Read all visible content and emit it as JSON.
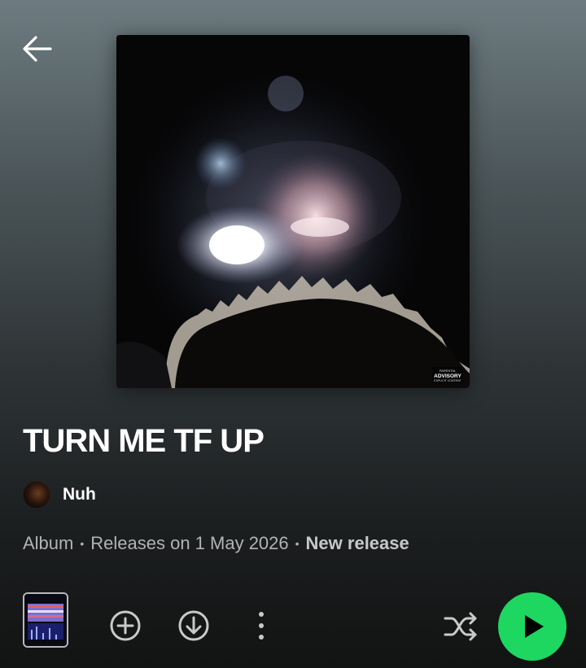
{
  "header": {
    "back_icon": "arrow-left-icon"
  },
  "album": {
    "title": "TURN ME TF UP",
    "artist": "Nuh",
    "type": "Album",
    "release_text": "Releases on 1 May 2026",
    "badge": "New release",
    "separator": "•",
    "cover_label": "PARENTAL ADVISORY EXPLICIT CONTENT"
  },
  "controls": {
    "add_icon": "add-circle-icon",
    "download_icon": "download-icon",
    "more_icon": "more-vertical-icon",
    "shuffle_icon": "shuffle-icon",
    "play_icon": "play-icon",
    "play_color": "#1ed760"
  }
}
